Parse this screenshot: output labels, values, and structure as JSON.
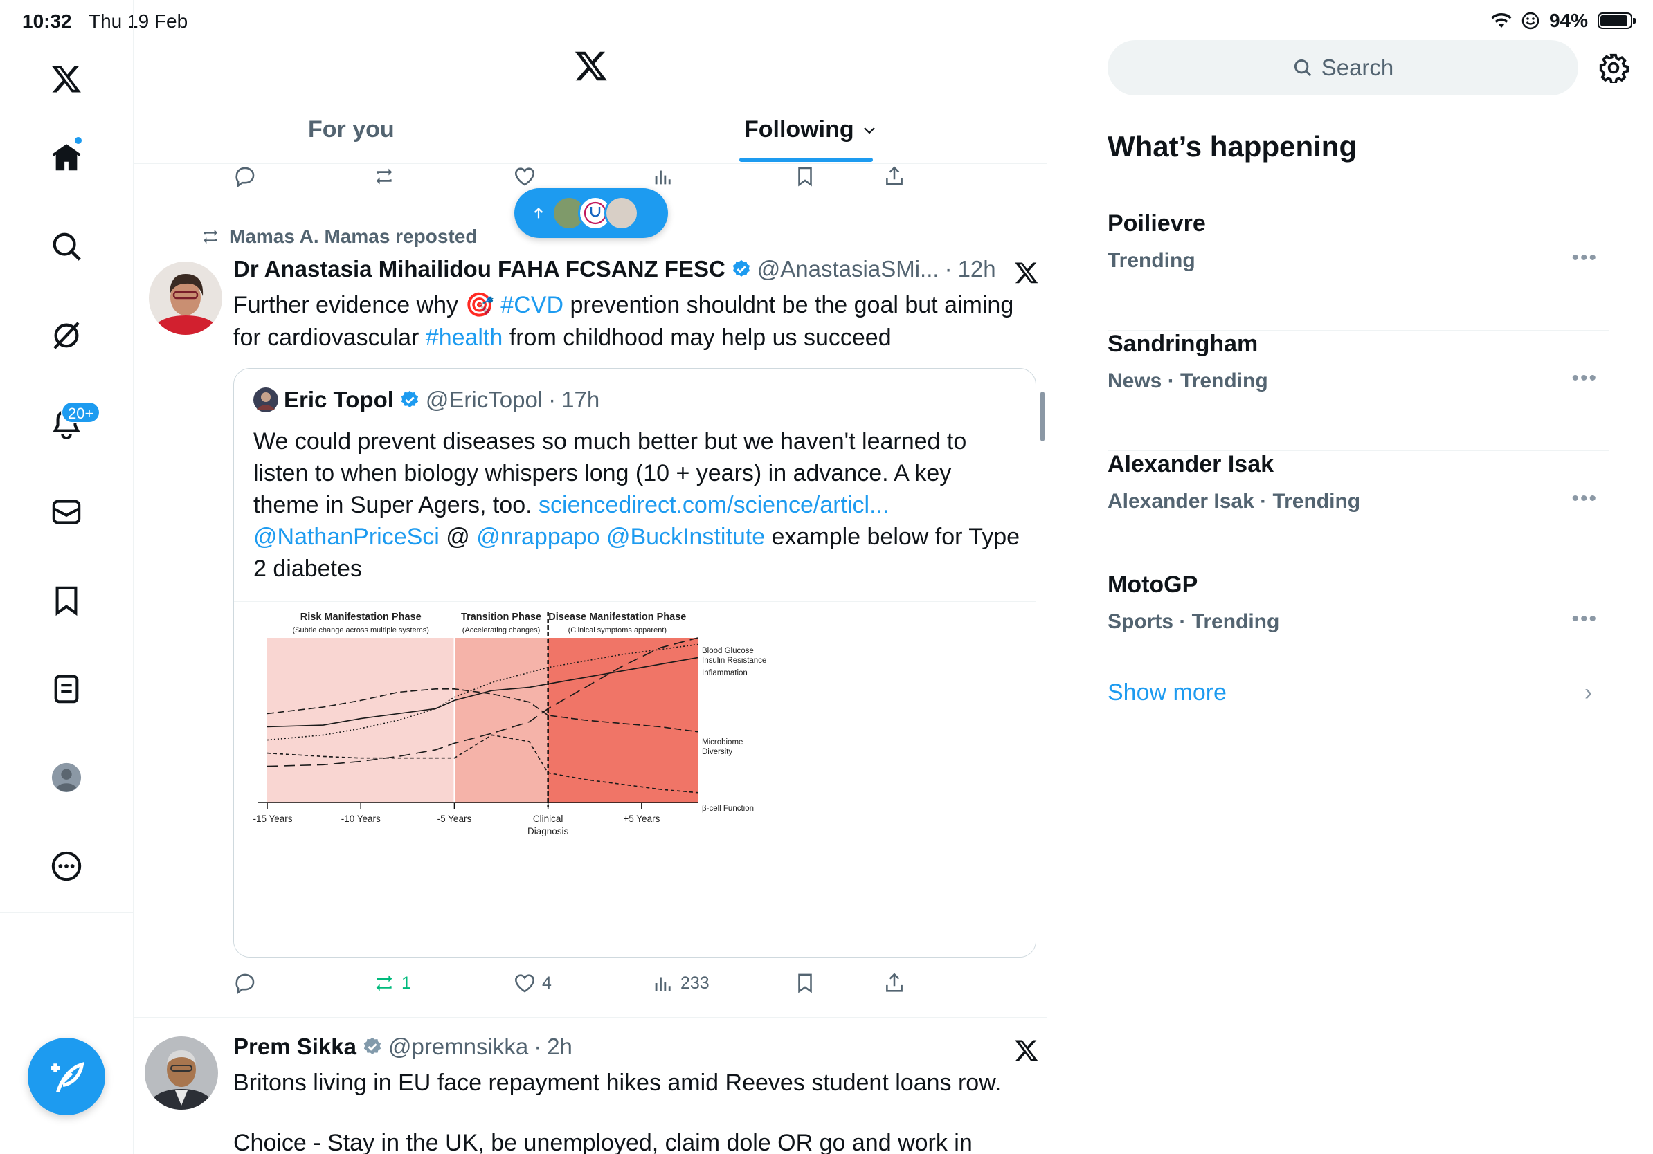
{
  "status_bar": {
    "time": "10:32",
    "date": "Thu 19 Feb",
    "battery": "94%",
    "battery_level": 0.94
  },
  "nav": {
    "items": [
      "x-logo",
      "home",
      "search",
      "grok",
      "notifications",
      "messages",
      "bookmarks",
      "lists",
      "profile",
      "more"
    ],
    "notifications_badge": "20+"
  },
  "timeline": {
    "tabs": [
      {
        "label": "For you",
        "active": false
      },
      {
        "label": "Following",
        "active": true
      }
    ],
    "repost": {
      "reposter": "Mamas A. Mamas reposted",
      "author_name": "Dr Anastasia Mihailidou FAHA FCSANZ FESC",
      "author_handle": "@AnastasiaSMi...",
      "time": "12h",
      "text_parts": [
        "Further evidence why ",
        "🎯",
        " ",
        "#CVD",
        " prevention shouldnt be the goal but aiming for cardiovascular ",
        "#health",
        " from childhood may help us succeed"
      ],
      "quote": {
        "name": "Eric Topol",
        "handle": "@EricTopol",
        "time": "17h",
        "text": "We could prevent diseases so much better but we haven't learned to listen to when biology whispers long (10 + years) in advance. A key theme in Super Agers, too.",
        "link1": "sciencedirect.com/science/articl...",
        "mention1": "@NathanPriceSci",
        "at": " @ ",
        "mention2": "@nrappapo",
        "mention3": "@BuckInstitute",
        "tail": " example below for Type 2 diabetes"
      },
      "stats": {
        "replies": "",
        "reposts": "1",
        "likes": "4",
        "views": "233"
      }
    },
    "next_post": {
      "author_name": "Prem Sikka",
      "author_handle": "@premnsikka",
      "time": "2h",
      "line1": "Britons living in EU face repayment hikes amid Reeves student loans row.",
      "line2": "Choice - Stay in the UK, be unemployed, claim dole OR go and work in"
    }
  },
  "chart_data": {
    "type": "line",
    "phases": [
      {
        "title": "Risk Manifestation Phase",
        "subtitle": "(Subtle change across multiple systems)",
        "color": "#f9d6d2"
      },
      {
        "title": "Transition Phase",
        "subtitle": "(Accelerating changes)",
        "color": "#f5b3a9"
      },
      {
        "title": "Disease Manifestation Phase",
        "subtitle": "(Clinical symptoms apparent)",
        "color": "#f07567"
      }
    ],
    "x_ticks": [
      "-15 Years",
      "-10 Years",
      "-5 Years",
      "Clinical Diagnosis",
      "+5 Years"
    ],
    "x": [
      -15,
      -10,
      -5,
      0,
      5
    ],
    "xlim": [
      -15,
      8
    ],
    "ylim": [
      0,
      10
    ],
    "series": [
      {
        "name": "Blood Glucose",
        "style": "longdash",
        "x": [
          -15,
          -12,
          -10,
          -8,
          -6,
          -5,
          -3,
          -1,
          0,
          2,
          4,
          6,
          8
        ],
        "y": [
          2.2,
          2.3,
          2.5,
          2.8,
          3.2,
          3.6,
          4.2,
          4.9,
          5.7,
          7.0,
          8.3,
          9.4,
          10.0
        ]
      },
      {
        "name": "Insulin Resistance",
        "style": "dotted",
        "x": [
          -15,
          -12,
          -10,
          -8,
          -6,
          -5,
          -3,
          -1,
          0,
          2,
          4,
          6,
          8
        ],
        "y": [
          3.8,
          4.1,
          4.5,
          5.0,
          5.7,
          6.4,
          7.3,
          7.9,
          8.2,
          8.6,
          9.0,
          9.3,
          9.6
        ]
      },
      {
        "name": "Inflammation",
        "style": "solid",
        "x": [
          -15,
          -12,
          -10,
          -8,
          -6,
          -5,
          -3,
          -1,
          0,
          2,
          4,
          6,
          8
        ],
        "y": [
          4.6,
          4.7,
          5.1,
          5.4,
          5.7,
          6.2,
          6.8,
          7.0,
          7.2,
          7.6,
          8.0,
          8.4,
          8.8
        ]
      },
      {
        "name": "Microbiome Diversity",
        "style": "dashed",
        "x": [
          -15,
          -12,
          -10,
          -8,
          -6,
          -5,
          -3,
          -1,
          0,
          2,
          4,
          6,
          8
        ],
        "y": [
          5.4,
          5.8,
          6.2,
          6.7,
          6.9,
          6.9,
          6.6,
          6.1,
          5.3,
          5.0,
          4.8,
          4.6,
          4.3
        ]
      },
      {
        "name": "β-cell Function",
        "style": "shortdash",
        "x": [
          -15,
          -12,
          -10,
          -8,
          -6,
          -5,
          -3,
          -1,
          0,
          2,
          4,
          6,
          8
        ],
        "y": [
          3.0,
          2.8,
          2.7,
          2.7,
          2.7,
          2.7,
          4.1,
          3.7,
          1.8,
          1.4,
          1.1,
          0.8,
          0.6
        ]
      }
    ]
  },
  "right": {
    "search_placeholder": "Search",
    "section_title": "What’s happening",
    "trends": [
      {
        "name": "Poilievre",
        "meta": "Trending"
      },
      {
        "name": "Sandringham",
        "meta": "News · Trending"
      },
      {
        "name": "Alexander Isak",
        "meta": "Alexander Isak · Trending"
      },
      {
        "name": "MotoGP",
        "meta": "Sports · Trending"
      }
    ],
    "show_more": "Show more"
  },
  "colors": {
    "accent": "#1d9bf0",
    "repost_active": "#00ba7c",
    "text": "#0f1419",
    "muted": "#536471"
  }
}
